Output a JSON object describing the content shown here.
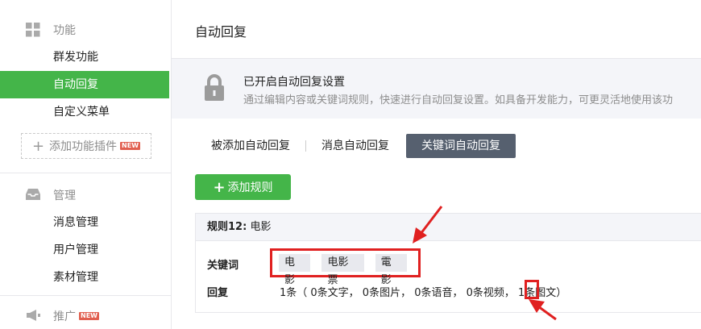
{
  "sidebar": {
    "sections": [
      {
        "label": "功能",
        "icon": "grid-icon",
        "new": ""
      },
      {
        "label": "管理",
        "icon": "inbox-icon",
        "new": ""
      },
      {
        "label": "推广",
        "icon": "megaphone-icon",
        "new": "NEW"
      }
    ],
    "function_items": [
      "群发功能",
      "自动回复",
      "自定义菜单"
    ],
    "add_plugin": {
      "label": "添加功能插件",
      "badge": "NEW"
    },
    "manage_items": [
      "消息管理",
      "用户管理",
      "素材管理"
    ],
    "active_color": "#44b549"
  },
  "main": {
    "title": "自动回复",
    "notice": {
      "icon": "lock-icon",
      "title": "已开启自动回复设置",
      "desc": "通过编辑内容或关键词规则，快速进行自动回复设置。如具备开发能力，可更灵活地使用该功"
    },
    "tabs": [
      "被添加自动回复",
      "消息自动回复",
      "关键词自动回复"
    ],
    "active_tab": "关键词自动回复",
    "add_rule_label": "添加规则",
    "rule": {
      "name_prefix": "规则12:",
      "name": "电影",
      "keyword_label": "关键词",
      "keywords": [
        "电影",
        "电影票",
        "電影"
      ],
      "reply_label": "回复",
      "reply_summary": "1条（ 0条文字， 0条图片， 0条语音， 0条视频， 1条图文）"
    }
  },
  "annotation_color": "#e02020"
}
